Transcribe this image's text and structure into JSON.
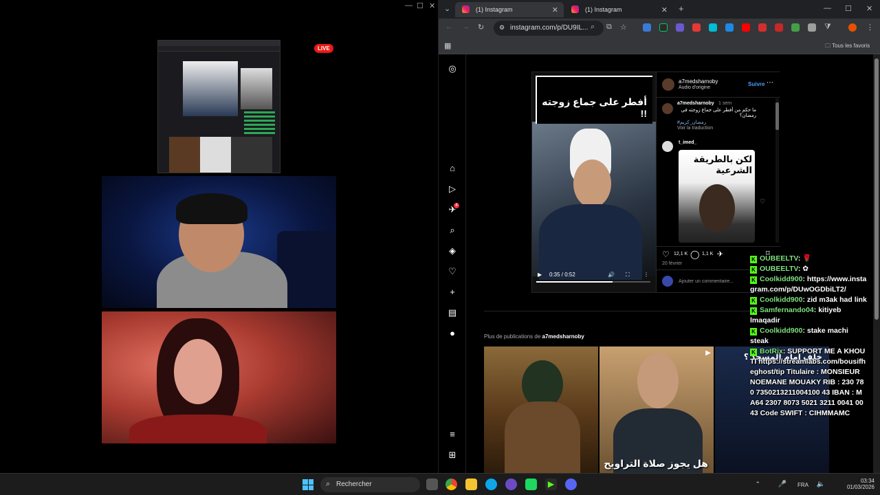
{
  "stream": {
    "live_badge": "LIVE"
  },
  "browser": {
    "tabs": [
      {
        "label": "(1) Instagram",
        "active": true
      },
      {
        "label": "(1) Instagram",
        "active": false
      }
    ],
    "url": "instagram.com/p/DU9IL...",
    "bookmarks_label": "Tous les favoris"
  },
  "post": {
    "video_title": "أفطر على جماع زوجته !!",
    "time": "0:35 / 0:52",
    "author": "a7medsharnoby",
    "audio": "Audio d'origine",
    "follow": "Suivre",
    "caption_author": "a7medsharnoby",
    "caption_age": "1 sem",
    "caption_text": "ما حكم من أفطر على جماع زوجته في رمضان؟",
    "caption_tag": "#رمضان_كريم",
    "translate": "Voir la traduction",
    "comment_author": "t_imed_",
    "comment_image_text": "لكن بالطريقة الشرعية",
    "likes": "12,1 K",
    "comments": "1,1 K",
    "date": "20 février",
    "add_comment": "Ajouter un commentaire..."
  },
  "more": {
    "prefix": "Plus de publications de",
    "user": "a7medsharnoby",
    "thumb2_text": "هل يجوز صلاة التراويح",
    "thumb3_text": "خلف إمام المسجد ؟"
  },
  "chat": [
    {
      "user": "OUBEELTV",
      "msg": ""
    },
    {
      "user": "OUBEELTV",
      "msg": ""
    },
    {
      "user": "Coolkidd900",
      "msg": "https://www.instagram.com/p/DUwOGDbiLT2/"
    },
    {
      "user": "Coolkidd900",
      "msg": "zid m3ak had link"
    },
    {
      "user": "Samfernando04",
      "msg": "kitiyeb lmaqadir"
    },
    {
      "user": "Coolkidd900",
      "msg": "stake machi steak"
    },
    {
      "user": "BotRix",
      "msg": "SUPPORT ME A KHOUTI https://streamlabs.com/bousifheghost/tip Titulaire : MONSIEUR NOEMANE MOUAKY RIB : 230 780 7350213211004100 43 IBAN : MA64 2307 8073 5021 3211 0041 0043 Code SWIFT : CIHMMAMC"
    }
  ],
  "taskbar": {
    "search": "Rechercher",
    "lang": "FRA",
    "time": "03:34",
    "date": "01/03/2026"
  }
}
